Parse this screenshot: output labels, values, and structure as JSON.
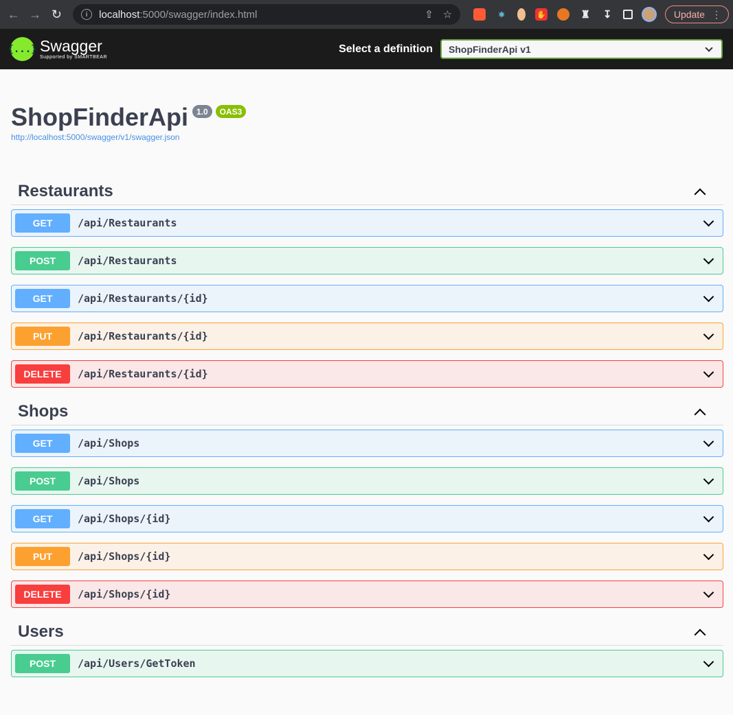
{
  "browser": {
    "url_host": "localhost",
    "url_rest": ":5000/swagger/index.html",
    "update_label": "Update"
  },
  "topbar": {
    "logo_text": "Swagger",
    "logo_sub": "Supported by SMARTBEAR",
    "logo_mark": "{...}",
    "select_label": "Select a definition",
    "selected_definition": "ShopFinderApi v1"
  },
  "info": {
    "title": "ShopFinderApi",
    "version": "1.0",
    "oas": "OAS3",
    "spec_url": "http://localhost:5000/swagger/v1/swagger.json"
  },
  "tags": [
    {
      "name": "Restaurants",
      "operations": [
        {
          "method": "GET",
          "path": "/api/Restaurants"
        },
        {
          "method": "POST",
          "path": "/api/Restaurants"
        },
        {
          "method": "GET",
          "path": "/api/Restaurants/{id}"
        },
        {
          "method": "PUT",
          "path": "/api/Restaurants/{id}"
        },
        {
          "method": "DELETE",
          "path": "/api/Restaurants/{id}"
        }
      ]
    },
    {
      "name": "Shops",
      "operations": [
        {
          "method": "GET",
          "path": "/api/Shops"
        },
        {
          "method": "POST",
          "path": "/api/Shops"
        },
        {
          "method": "GET",
          "path": "/api/Shops/{id}"
        },
        {
          "method": "PUT",
          "path": "/api/Shops/{id}"
        },
        {
          "method": "DELETE",
          "path": "/api/Shops/{id}"
        }
      ]
    },
    {
      "name": "Users",
      "operations": [
        {
          "method": "POST",
          "path": "/api/Users/GetToken"
        }
      ]
    }
  ],
  "colors": {
    "get": "#61affe",
    "post": "#49cc90",
    "put": "#fca130",
    "delete": "#f93e3e",
    "swagger_green": "#85ea2d"
  }
}
